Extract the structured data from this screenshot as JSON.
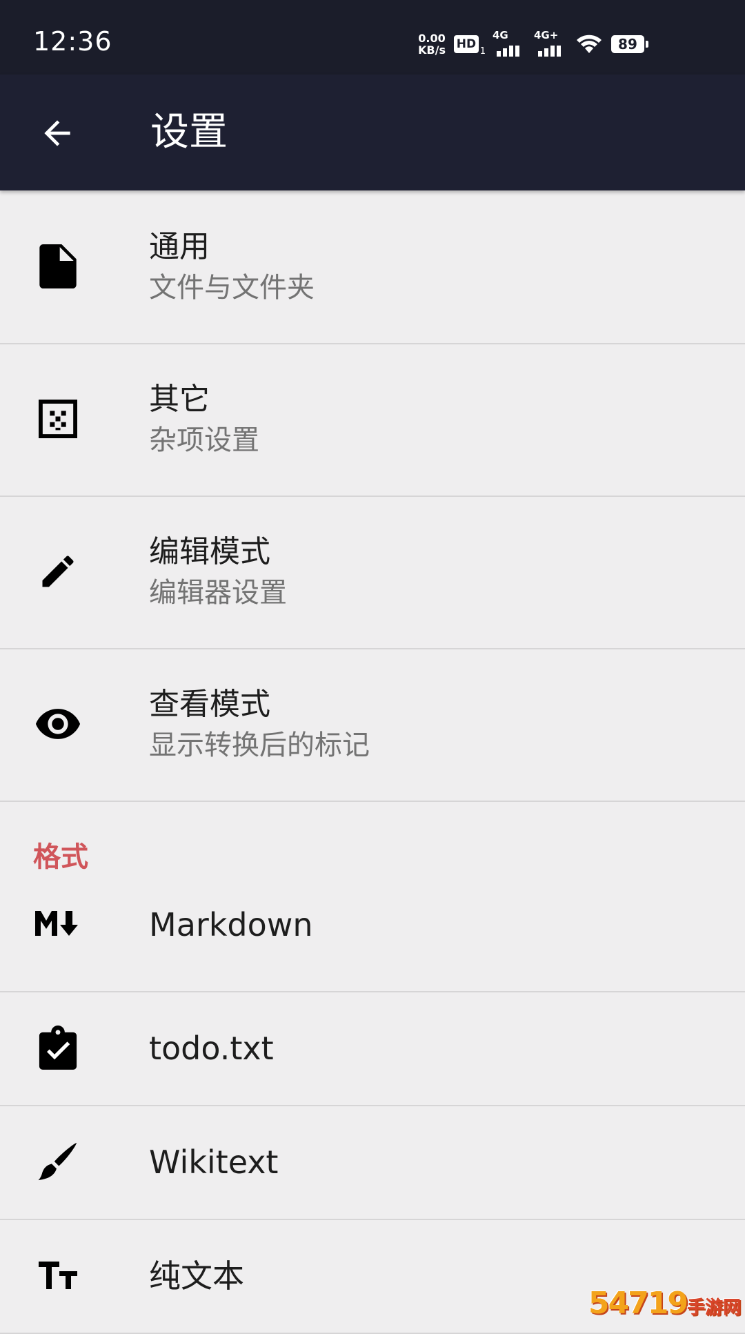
{
  "status_bar": {
    "time": "12:36",
    "net_speed_value": "0.00",
    "net_speed_unit": "KB/s",
    "hd_label": "HD",
    "hd_sub": "1",
    "signal1_label": "4G",
    "signal2_label": "4G+",
    "battery_level": "89"
  },
  "app_bar": {
    "title": "设置"
  },
  "prefs": [
    {
      "title": "通用",
      "summary": "文件与文件夹",
      "icon": "file-icon"
    },
    {
      "title": "其它",
      "summary": "杂项设置",
      "icon": "dots-grid-icon"
    },
    {
      "title": "编辑模式",
      "summary": "编辑器设置",
      "icon": "pencil-icon"
    },
    {
      "title": "查看模式",
      "summary": "显示转换后的标记",
      "icon": "eye-icon"
    }
  ],
  "format_category": {
    "title": "格式",
    "color": "#d0555a",
    "items": [
      {
        "title": "Markdown",
        "icon": "markdown-icon"
      },
      {
        "title": "todo.txt",
        "icon": "clipboard-check-icon"
      },
      {
        "title": "Wikitext",
        "icon": "brush-icon"
      },
      {
        "title": "纯文本",
        "icon": "text-format-icon"
      }
    ]
  },
  "watermark": {
    "main": "54719",
    "sub": "手游网"
  }
}
